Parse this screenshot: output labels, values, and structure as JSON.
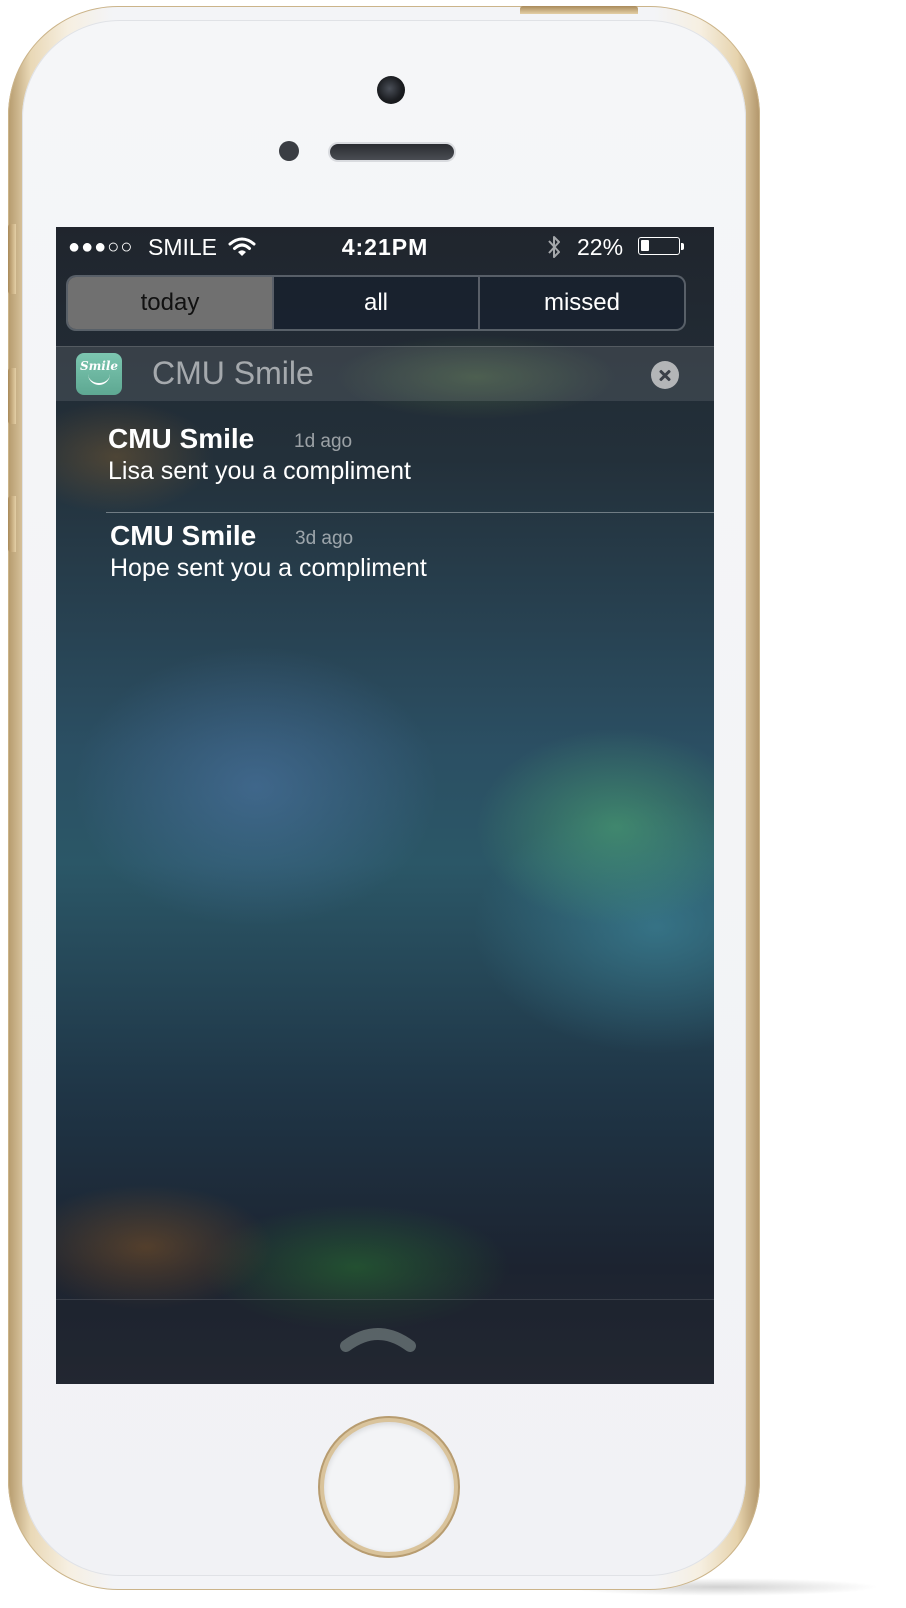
{
  "status_bar": {
    "signal_dots": "●●●○○",
    "carrier": "SMILE",
    "time": "4:21PM",
    "battery_percent": "22%",
    "battery_level": 0.22
  },
  "tabs": [
    {
      "label": "today",
      "active": true
    },
    {
      "label": "all",
      "active": false
    },
    {
      "label": "missed",
      "active": false
    }
  ],
  "group": {
    "app_name": "CMU Smile",
    "icon_text": "Smile",
    "icon": "smile-app-icon",
    "close_icon": "close-icon"
  },
  "notifications": [
    {
      "title": "CMU Smile",
      "time": "1d ago",
      "body": "Lisa sent you a compliment"
    },
    {
      "title": "CMU Smile",
      "time": "3d ago",
      "body": "Hope sent you a compliment"
    }
  ],
  "bottom": {
    "icon": "grabber-chevron-icon"
  },
  "colors": {
    "active_tab_bg": "#707070",
    "app_icon": "#6cb8a2",
    "phone_gold": "#d9c39b",
    "phone_face": "#f3f4f7"
  }
}
